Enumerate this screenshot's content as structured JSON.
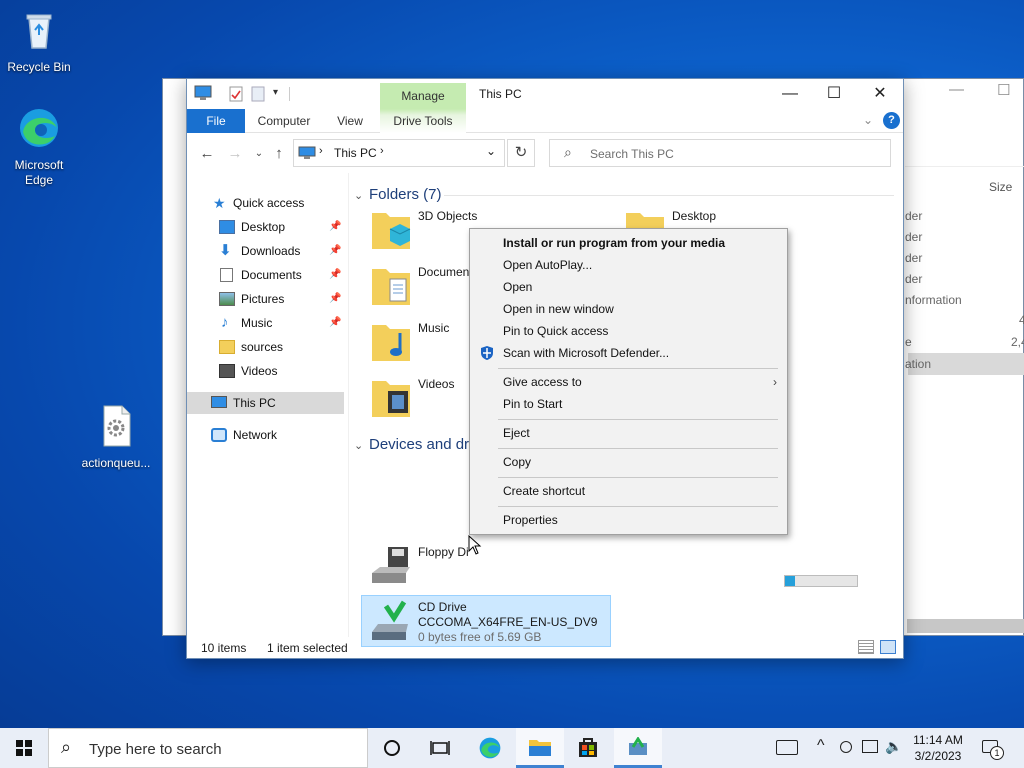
{
  "desktop": {
    "icons": [
      {
        "label": "Recycle Bin"
      },
      {
        "label": "Microsoft Edge"
      },
      {
        "label": "actionqueu..."
      }
    ]
  },
  "background_window": {
    "column_header": "Size",
    "fragments": [
      "der",
      "der",
      "der",
      "der",
      "nformation",
      "4",
      "e",
      "2,4",
      "ation"
    ]
  },
  "window": {
    "title": "This PC",
    "manage_tab": "Manage",
    "ribbon_tabs": [
      "File",
      "Computer",
      "View",
      "Drive Tools"
    ],
    "address": "This PC",
    "search_placeholder": "Search This PC",
    "controls": {
      "minimize": "—",
      "maximize": "☐",
      "close": "✕"
    },
    "nav_pane": {
      "quick_access": "Quick access",
      "items": [
        {
          "label": "Desktop",
          "pinned": true
        },
        {
          "label": "Downloads",
          "pinned": true
        },
        {
          "label": "Documents",
          "pinned": true
        },
        {
          "label": "Pictures",
          "pinned": true
        },
        {
          "label": "Music",
          "pinned": true
        },
        {
          "label": "sources",
          "pinned": false
        },
        {
          "label": "Videos",
          "pinned": false
        }
      ],
      "this_pc": "This PC",
      "network": "Network"
    },
    "folders_header": "Folders (7)",
    "folders": [
      "3D Objects",
      "Documen",
      "Music",
      "Videos",
      "Desktop"
    ],
    "devices_header": "Devices and dri",
    "devices": [
      {
        "name": "Floppy Di",
        "detail": ""
      },
      {
        "name": "CD Drive",
        "label": "CCCOMA_X64FRE_EN-US_DV9",
        "detail": "0 bytes free of 5.69 GB"
      }
    ],
    "status": {
      "items": "10 items",
      "selected": "1 item selected"
    }
  },
  "context_menu": {
    "items": [
      {
        "label": "Install or run program from your media",
        "bold": true
      },
      {
        "label": "Open AutoPlay..."
      },
      {
        "label": "Open"
      },
      {
        "label": "Open in new window"
      },
      {
        "label": "Pin to Quick access"
      },
      {
        "label": "Scan with Microsoft Defender...",
        "icon": "defender-shield-icon"
      },
      {
        "label": "Give access to",
        "submenu": true
      },
      {
        "label": "Pin to Start"
      },
      {
        "label": "Eject"
      },
      {
        "label": "Copy"
      },
      {
        "label": "Create shortcut"
      },
      {
        "label": "Properties"
      }
    ]
  },
  "taskbar": {
    "search_placeholder": "Type here to search",
    "time": "11:14 AM",
    "date": "3/2/2023",
    "notification_count": "1"
  },
  "colors": {
    "accent": "#1970cf",
    "manage_green": "#c5ebb1",
    "selection": "#cce8ff"
  }
}
